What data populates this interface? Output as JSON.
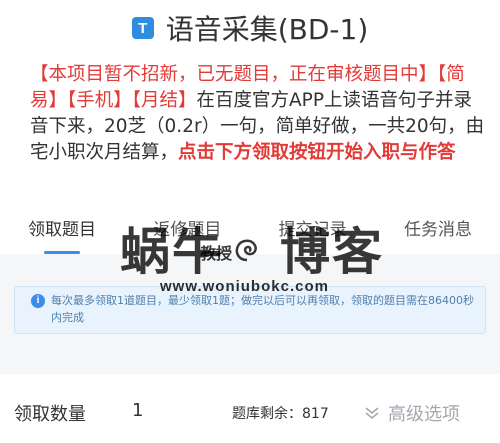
{
  "header": {
    "badge_letter": "T",
    "title": "语音采集(BD-1)"
  },
  "description": {
    "red_part": "【本项目暂不招新，已无题目，正在审核题目中】【简易】【手机】【月结】",
    "normal_part": "在百度官方APP上读语音句子并录音下来，20芝（0.2r）一句，简单好做，一共20句，由宅小职次月结算，",
    "bold_part": "点击下方领取按钮开始入职与作答"
  },
  "tabs": [
    {
      "label": "领取题目"
    },
    {
      "label": "返修题目"
    },
    {
      "label": "提交记录"
    },
    {
      "label": "任务消息"
    }
  ],
  "notice": {
    "text": "每次最多领取1道题目，最少领取1题；做完以后可以再领取，领取的题目需在86400秒内完成"
  },
  "watermark": {
    "big_left": "蜗牛",
    "big_right": "博客",
    "small": "教授",
    "url": "www.woniubokc.com"
  },
  "footer": {
    "quantity_label": "领取数量",
    "quantity_value": "1",
    "stock_text": "题库剩余：817",
    "advanced_label": "高级选项"
  },
  "colors": {
    "accent": "#3a8ee6",
    "red": "#e23a36",
    "notice_bg": "#e8f3fd"
  }
}
